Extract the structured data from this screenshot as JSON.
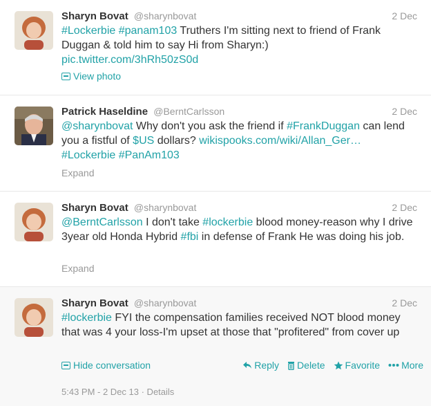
{
  "tweets": [
    {
      "fullname": "Sharyn Bovat",
      "username": "@sharynbovat",
      "time": "2 Dec",
      "text_parts": [
        "#Lockerbie",
        " ",
        "#panam103",
        " Truthers I'm sitting next to friend of Frank Duggan & told him to say Hi from Sharyn:) "
      ],
      "link": "pic.twitter.com/3hRh50zS0d",
      "meta_label": "View photo"
    },
    {
      "fullname": "Patrick Haseldine",
      "username": "@BerntCarlsson",
      "time": "2 Dec",
      "parts": {
        "p1": "@sharynbovat",
        "p2": " Why don't you ask the friend if ",
        "p3": "#FrankDuggan",
        "p4": " can lend you a fistful of ",
        "p5": "$US",
        "p6": " dollars? ",
        "p7": "wikispooks.com/wiki/Allan_Ger…",
        "p8": "#Lockerbie",
        "p9": " ",
        "p10": "#PanAm103"
      },
      "meta_label": "Expand"
    },
    {
      "fullname": "Sharyn Bovat",
      "username": "@sharynbovat",
      "time": "2 Dec",
      "parts": {
        "p1": "@BerntCarlsson",
        "p2": " I don't take ",
        "p3": "#lockerbie",
        "p4": " blood money-reason why I drive 3year old Honda Hybrid ",
        "p5": "#fbi",
        "p6": " in defense of Frank He was doing his job."
      },
      "meta_label": "Expand"
    },
    {
      "fullname": "Sharyn Bovat",
      "username": "@sharynbovat",
      "time": "2 Dec",
      "parts": {
        "p1": "#lockerbie",
        "p2": " FYI the compensation families received NOT blood money that was 4 your loss-I'm upset at those that \"profitered\" from cover up"
      },
      "hide_label": "Hide conversation",
      "actions": {
        "reply": "Reply",
        "delete": "Delete",
        "favorite": "Favorite",
        "more": "More"
      },
      "footer": "5:43 PM - 2 Dec 13 · Details"
    }
  ],
  "colors": {
    "link": "#21a2a7",
    "muted": "#999999",
    "text": "#333333"
  }
}
